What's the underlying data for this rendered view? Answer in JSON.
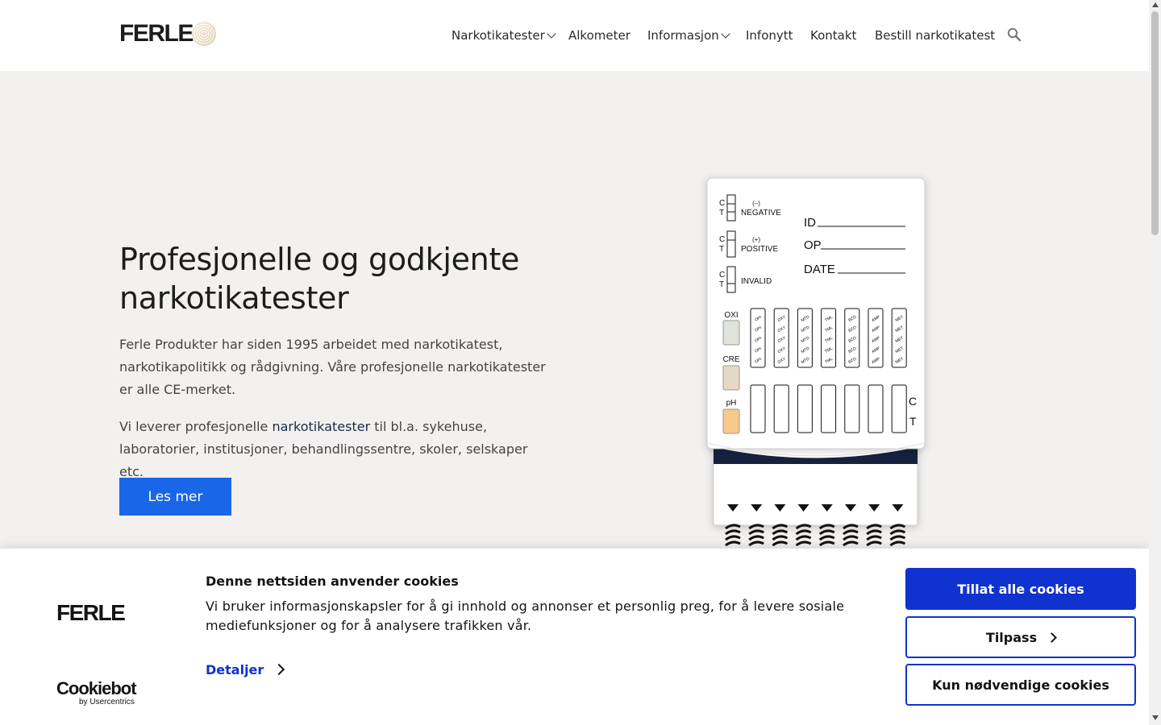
{
  "header": {
    "logo_text": "FERLE",
    "nav": [
      {
        "label": "Narkotikatester",
        "dropdown": true
      },
      {
        "label": "Alkometer",
        "dropdown": false
      },
      {
        "label": "Informasjon",
        "dropdown": true
      },
      {
        "label": "Infonytt",
        "dropdown": false
      },
      {
        "label": "Kontakt",
        "dropdown": false
      },
      {
        "label": "Bestill narkotikatest",
        "dropdown": false
      }
    ],
    "search_icon": "search-icon"
  },
  "hero": {
    "title_line1": "Profesjonelle og godkjente",
    "title_line2": "narkotikatester",
    "paragraph1": "Ferle Produkter har siden 1995 arbeidet med narkotikatest, narkotikapolitikk og rådgivning. Våre profesjonelle narkotikatester er alle CE-merket.",
    "paragraph2_before": "Vi leverer profesjonelle ",
    "paragraph2_link": "narkotikatester",
    "paragraph2_after": " til bl.a. sykehuse, laboratorier, institusjoner, behandlingssentre, skoler, selskaper etc.",
    "button_label": "Les mer"
  },
  "device": {
    "legend": [
      {
        "sign": "(–)",
        "label": "NEGATIVE"
      },
      {
        "sign": "(+)",
        "label": "POSITIVE"
      },
      {
        "sign": "",
        "label": "INVALID"
      }
    ],
    "ct_c": "C",
    "ct_t": "T",
    "fields": [
      "ID",
      "OP",
      "DATE"
    ],
    "adulterants": [
      "OXI",
      "CRE",
      "pH"
    ],
    "strips": [
      "OPI",
      "OXY",
      "MTD",
      "TML",
      "BZO",
      "AMP",
      "MET"
    ],
    "colors": {
      "navy": "#16213e",
      "oxi": "#dfe3d9",
      "cre": "#e5d8c6",
      "ph": "#f7c98a"
    }
  },
  "cookie": {
    "logo_text": "FERLE",
    "title": "Denne nettsiden anvender cookies",
    "text": "Vi bruker informasjonskapsler for å gi innhold og annonser et personlig preg, for å levere sosiale mediefunksjoner og for å analysere trafikken vår.",
    "details_label": "Detaljer",
    "cookiebot_name": "Cookiebot",
    "cookiebot_by": "by Usercentrics",
    "btn_allow": "Tillat alle cookies",
    "btn_customize": "Tilpass",
    "btn_necessary": "Kun nødvendige cookies"
  }
}
